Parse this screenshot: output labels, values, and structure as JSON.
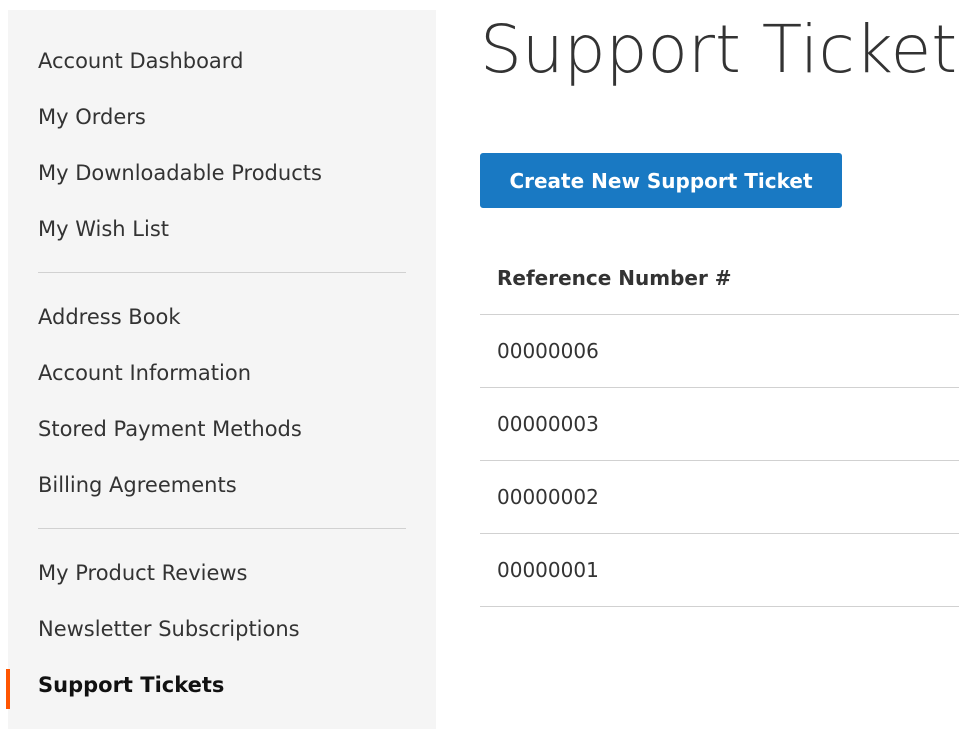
{
  "sidebar": {
    "groups": [
      [
        "Account Dashboard",
        "My Orders",
        "My Downloadable Products",
        "My Wish List"
      ],
      [
        "Address Book",
        "Account Information",
        "Stored Payment Methods",
        "Billing Agreements"
      ],
      [
        "My Product Reviews",
        "Newsletter Subscriptions",
        "Support Tickets"
      ]
    ],
    "current": "Support Tickets"
  },
  "main": {
    "title": "Support Tickets",
    "create_button_label": "Create New Support Ticket",
    "table": {
      "header": "Reference Number #",
      "rows": [
        "00000006",
        "00000003",
        "00000002",
        "00000001"
      ]
    }
  },
  "colors": {
    "accent_blue": "#1979c3",
    "current_marker": "#ff5501",
    "sidebar_bg": "#f5f5f5",
    "divider": "#d1d1d1"
  }
}
